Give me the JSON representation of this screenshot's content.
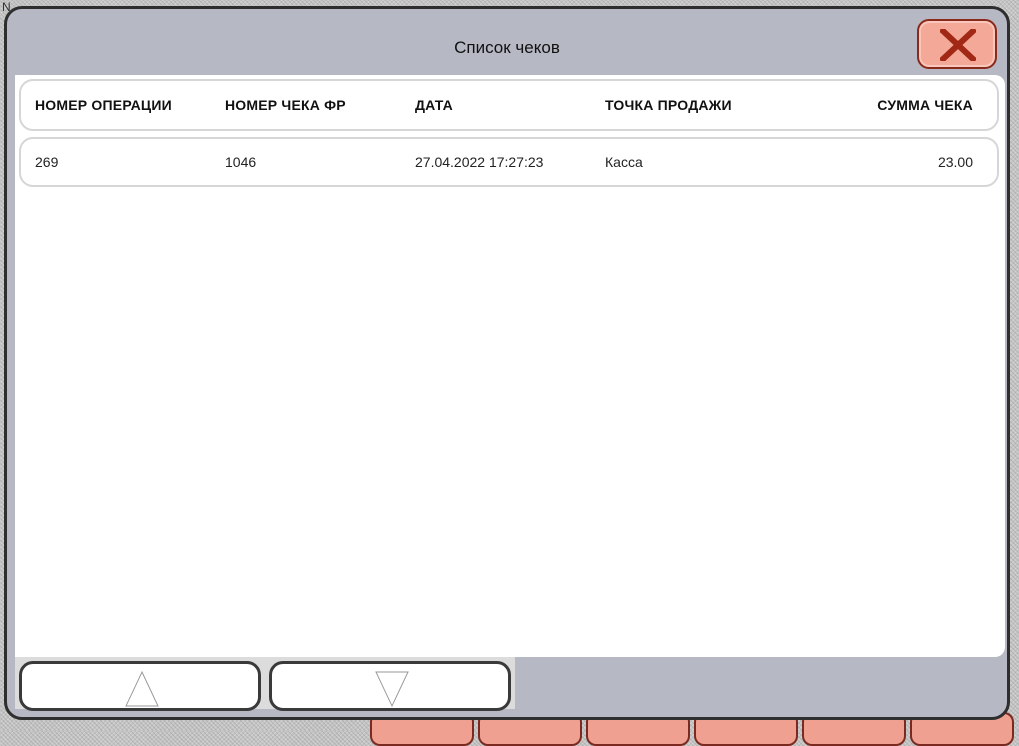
{
  "dialog": {
    "title": "Список чеков",
    "close_icon": "close-x-icon"
  },
  "table": {
    "columns": [
      "НОМЕР ОПЕРАЦИИ",
      "НОМЕР ЧЕКА ФР",
      "ДАТА",
      "ТОЧКА ПРОДАЖИ",
      "СУММА ЧЕКА"
    ],
    "rows": [
      [
        "269",
        "1046",
        "27.04.2022 17:27:23",
        "Касса",
        "23.00"
      ]
    ]
  },
  "navigation": {
    "up_icon": "triangle-up-icon",
    "down_icon": "triangle-down-icon"
  },
  "colors": {
    "dialog_bg": "#b6b8c4",
    "close_button_bg": "#f4a898",
    "close_icon": "#a02814"
  }
}
